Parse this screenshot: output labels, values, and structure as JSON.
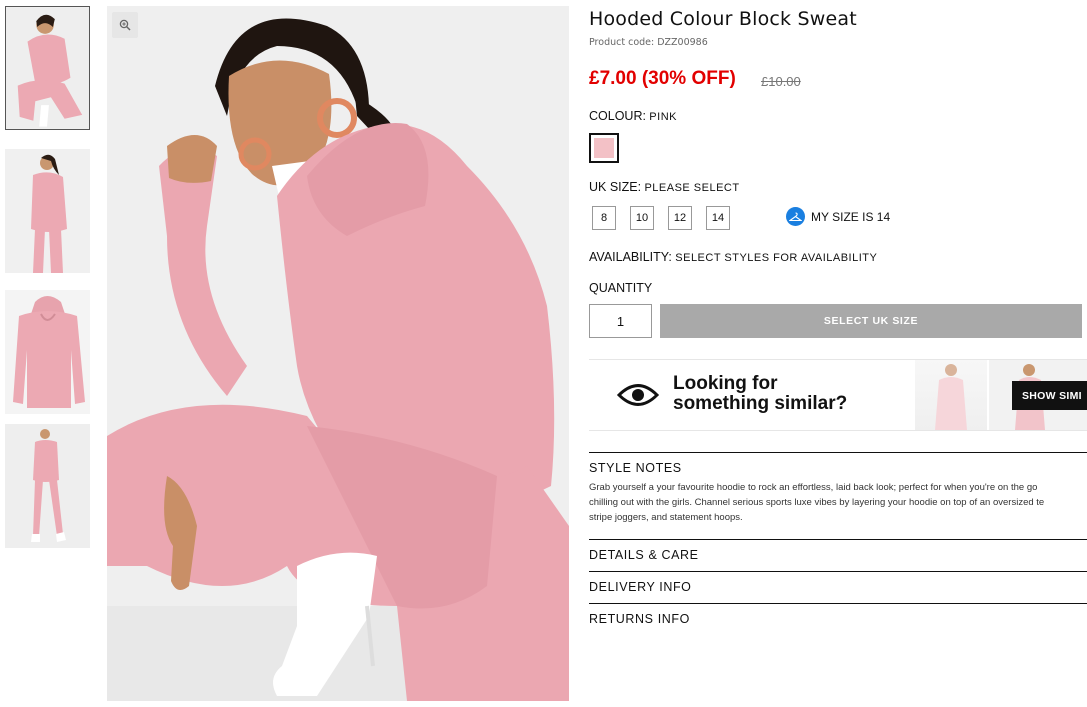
{
  "product": {
    "title": "Hooded Colour Block Sweat",
    "code": "Product code: DZZ00986",
    "price": "£7.00 (30% OFF)",
    "old_price": "£10.00"
  },
  "colour": {
    "label": "COLOUR:",
    "value": "PINK",
    "swatch_color": "#f3c1c6"
  },
  "size": {
    "label": "UK SIZE:",
    "value": "PLEASE SELECT",
    "options": [
      "8",
      "10",
      "12",
      "14"
    ],
    "my_size": "MY SIZE IS 14"
  },
  "availability": {
    "label": "AVAILABILITY:",
    "value": "SELECT STYLES FOR AVAILABILITY"
  },
  "quantity": {
    "label": "QUANTITY",
    "value": "1"
  },
  "add_button": "SELECT UK SIZE",
  "similar": {
    "line1": "Looking for",
    "line2": "something similar?",
    "button": "SHOW SIMI"
  },
  "sections": {
    "style_notes": "STYLE NOTES",
    "style_notes_body": [
      "Grab yourself a your favourite hoodie to rock an effortless, laid back look; perfect for when you're on the go",
      "chilling out with the girls. Channel serious sports luxe vibes by layering your hoodie on top of an oversized te",
      "stripe joggers, and statement hoops."
    ],
    "details": "DETAILS & CARE",
    "delivery": "DELIVERY INFO",
    "returns": "RETURNS INFO"
  },
  "icons": [
    "zoom-icon",
    "hanger-icon",
    "eye-icon"
  ],
  "colors": {
    "price_red": "#e20000",
    "button_grey": "#a9a9a9",
    "accent_blue": "#1a7fe0",
    "product_pink": "#f3c1c6"
  }
}
